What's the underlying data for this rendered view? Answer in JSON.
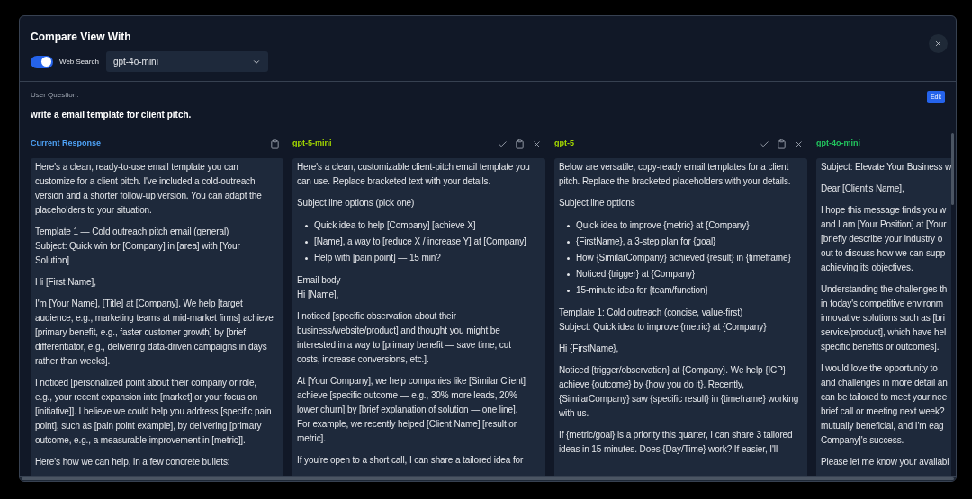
{
  "dialog": {
    "title": "Compare View With"
  },
  "web_search": {
    "label": "Web Search",
    "on": true
  },
  "model_select": {
    "value": "gpt-4o-mini"
  },
  "question": {
    "label": "User Question:",
    "text": "write a email template for client pitch.",
    "edit_button": "Edit"
  },
  "columns": [
    {
      "title": "Current Response",
      "kind": "current",
      "color": "#4ea1f5",
      "blocks": [
        {
          "kind": "text",
          "lines": [
            "Here's a clean, ready-to-use email template you can",
            "customize for a client pitch. I've included a cold-outreach",
            "version and a shorter follow-up version. You can adapt the",
            "placeholders to your situation."
          ]
        },
        {
          "kind": "text",
          "lines": [
            "Template 1 — Cold outreach pitch email (general)",
            "Subject: Quick win for [Company] in [area] with [Your",
            "Solution]"
          ]
        },
        {
          "kind": "text",
          "lines": [
            "Hi [First Name],"
          ]
        },
        {
          "kind": "text",
          "lines": [
            "I'm [Your Name], [Title] at [Company]. We help [target",
            "audience, e.g., marketing teams at mid-market firms] achieve",
            "[primary benefit, e.g., faster customer growth] by [brief",
            "differentiator, e.g., delivering data-driven campaigns in days",
            "rather than weeks]."
          ]
        },
        {
          "kind": "text",
          "lines": [
            "I noticed [personalized point about their company or role,",
            "e.g., your recent expansion into [market] or your focus on",
            "[initiative]]. I believe we could help you address [specific pain",
            "point], such as [pain point example], by delivering [primary",
            "outcome, e.g., a measurable improvement in [metric]]."
          ]
        },
        {
          "kind": "text",
          "lines": [
            "Here's how we can help, in a few concrete bullets:"
          ]
        }
      ]
    },
    {
      "title": "gpt-5-mini",
      "kind": "model",
      "color": "#a3d800",
      "blocks": [
        {
          "kind": "text",
          "lines": [
            "Here's a clean, customizable client-pitch email template you",
            "can use. Replace bracketed text with your details."
          ]
        },
        {
          "kind": "text",
          "lines": [
            "Subject line options (pick one)"
          ]
        },
        {
          "kind": "bullets",
          "lines": [
            "Quick idea to help [Company] [achieve X]",
            "[Name], a way to [reduce X / increase Y] at [Company]",
            "Help with [pain point] — 15 min?"
          ]
        },
        {
          "kind": "text",
          "lines": [
            "Email body",
            "Hi [Name],"
          ]
        },
        {
          "kind": "text",
          "lines": [
            "I noticed [specific observation about their",
            "business/website/product] and thought you might be",
            "interested in a way to [primary benefit — save time, cut",
            "costs, increase conversions, etc.]."
          ]
        },
        {
          "kind": "text",
          "lines": [
            "At [Your Company], we help companies like [Similar Client]",
            "achieve [specific outcome — e.g., 30% more leads, 20%",
            "lower churn] by [brief explanation of solution — one line].",
            "For example, we recently helped [Client Name] [result or",
            "metric]."
          ]
        },
        {
          "kind": "text",
          "lines": [
            "If you're open to a short call, I can share a tailored idea for"
          ]
        }
      ]
    },
    {
      "title": "gpt-5",
      "kind": "model",
      "color": "#a3d800",
      "blocks": [
        {
          "kind": "text",
          "lines": [
            "Below are versatile, copy-ready email templates for a client",
            "pitch. Replace the bracketed placeholders with your details."
          ]
        },
        {
          "kind": "text",
          "lines": [
            "Subject line options"
          ]
        },
        {
          "kind": "bullets",
          "lines": [
            "Quick idea to improve {metric} at {Company}",
            "{FirstName}, a 3-step plan for {goal}",
            "How {SimilarCompany} achieved {result} in {timeframe}",
            "Noticed {trigger} at {Company}",
            "15-minute idea for {team/function}"
          ]
        },
        {
          "kind": "text",
          "lines": [
            "Template 1: Cold outreach (concise, value-first)",
            "Subject: Quick idea to improve {metric} at {Company}"
          ]
        },
        {
          "kind": "text",
          "lines": [
            "Hi {FirstName},"
          ]
        },
        {
          "kind": "text",
          "lines": [
            "Noticed {trigger/observation} at {Company}. We help {ICP}",
            "achieve {outcome} by {how you do it}. Recently,",
            "{SimilarCompany} saw {specific result} in {timeframe} working",
            "with us."
          ]
        },
        {
          "kind": "text",
          "lines": [
            "If {metric/goal} is a priority this quarter, I can share 3 tailored",
            "ideas in 15 minutes. Does {Day/Time} work? If easier, I'll"
          ]
        }
      ]
    },
    {
      "title": "gpt-4o-mini",
      "kind": "model",
      "color": "#22c55e",
      "blocks": [
        {
          "kind": "text",
          "lines": [
            "Subject: Elevate Your Business w"
          ]
        },
        {
          "kind": "text",
          "lines": [
            "Dear [Client's Name],"
          ]
        },
        {
          "kind": "text",
          "lines": [
            "I hope this message finds you w",
            "and I am [Your Position] at [Your",
            "[briefly describe your industry o",
            "out to discuss how we can supp",
            "achieving its objectives."
          ]
        },
        {
          "kind": "text",
          "lines": [
            "Understanding the challenges th",
            "in today's competitive environm",
            "innovative solutions such as [bri",
            "service/product], which have hel",
            "specific benefits or outcomes]."
          ]
        },
        {
          "kind": "text",
          "lines": [
            "I would love the opportunity to",
            "and challenges in more detail an",
            "can be tailored to meet your nee",
            "brief call or meeting next week?",
            "mutually beneficial, and I'm eag",
            "Company]'s success."
          ]
        },
        {
          "kind": "text",
          "lines": [
            "Please let me know your availabi"
          ]
        }
      ]
    }
  ]
}
